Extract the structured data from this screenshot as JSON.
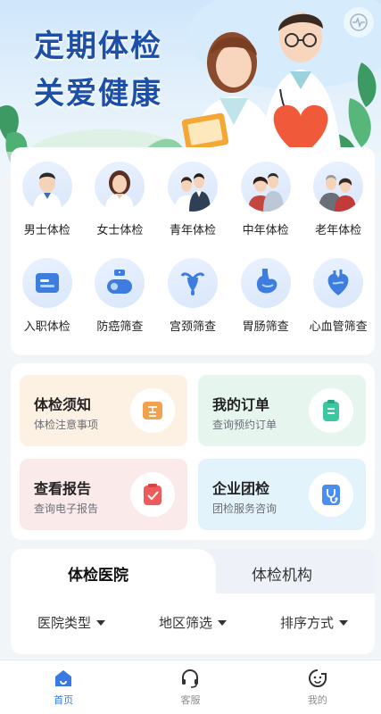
{
  "banner": {
    "title_line1": "定期体检",
    "title_line2": "关爱健康"
  },
  "categories": [
    {
      "label": "男士体检",
      "icon": "man-doctor-icon"
    },
    {
      "label": "女士体检",
      "icon": "woman-doctor-icon"
    },
    {
      "label": "青年体检",
      "icon": "young-couple-icon"
    },
    {
      "label": "中年体检",
      "icon": "middle-aged-couple-icon"
    },
    {
      "label": "老年体检",
      "icon": "elderly-couple-icon"
    },
    {
      "label": "入职体检",
      "icon": "id-card-icon"
    },
    {
      "label": "防癌筛查",
      "icon": "cancer-screen-icon"
    },
    {
      "label": "宫颈筛查",
      "icon": "uterus-icon"
    },
    {
      "label": "胃肠筛查",
      "icon": "stomach-icon"
    },
    {
      "label": "心血管筛查",
      "icon": "heart-icon"
    }
  ],
  "services": [
    {
      "title": "体检须知",
      "subtitle": "体检注意事项",
      "icon": "notice-icon",
      "color": "#f2a14f"
    },
    {
      "title": "我的订单",
      "subtitle": "查询预约订单",
      "icon": "order-icon",
      "color": "#3cc7a0"
    },
    {
      "title": "查看报告",
      "subtitle": "查询电子报告",
      "icon": "report-icon",
      "color": "#ef5a5a"
    },
    {
      "title": "企业团检",
      "subtitle": "团检服务咨询",
      "icon": "stethoscope-icon",
      "color": "#4a8ff0"
    }
  ],
  "tabs": [
    {
      "label": "体检医院",
      "active": true
    },
    {
      "label": "体检机构",
      "active": false
    }
  ],
  "filters": [
    {
      "label": "医院类型"
    },
    {
      "label": "地区筛选"
    },
    {
      "label": "排序方式"
    }
  ],
  "bottom_nav": [
    {
      "label": "首页",
      "icon": "home-icon",
      "active": true
    },
    {
      "label": "客服",
      "icon": "headset-icon",
      "active": false
    },
    {
      "label": "我的",
      "icon": "profile-icon",
      "active": false
    }
  ],
  "colors": {
    "brand_blue": "#1c4fa8",
    "accent": "#3a7ae0"
  }
}
